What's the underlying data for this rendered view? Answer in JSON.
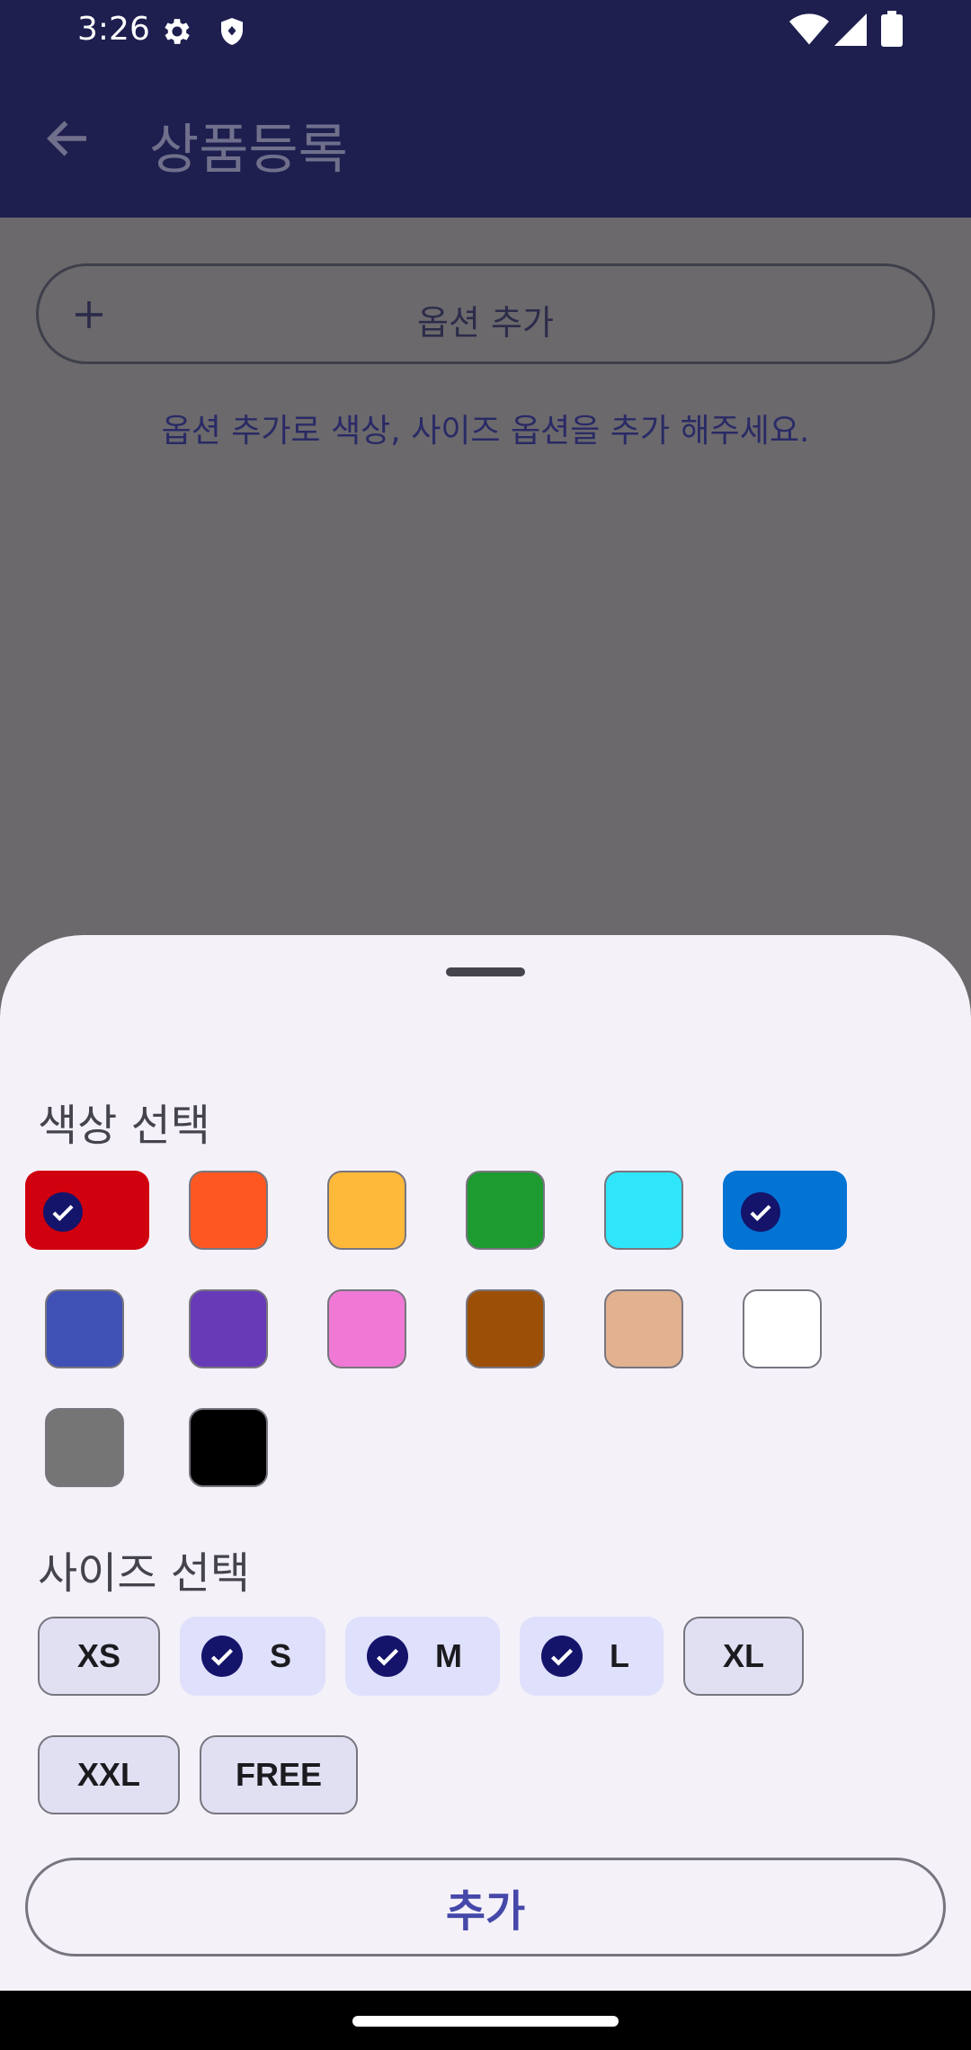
{
  "status_bar": {
    "time": "3:26",
    "icons": [
      "gear-icon",
      "shield-icon",
      "wifi-icon",
      "signal-icon",
      "battery-icon"
    ]
  },
  "app_bar": {
    "back_icon": "arrow-left-icon",
    "title": "상품등록"
  },
  "content": {
    "option_add_label": "옵션 추가",
    "hint": "옵션 추가로 색상, 사이즈 옵션을 추가 해주세요."
  },
  "sheet": {
    "color_section_title": "색상 선택",
    "colors": [
      {
        "hex": "#d1000f",
        "selected": true
      },
      {
        "hex": "#ff5722",
        "selected": false
      },
      {
        "hex": "#ffb93a",
        "selected": false
      },
      {
        "hex": "#1d9a30",
        "selected": false
      },
      {
        "hex": "#2fe5fa",
        "selected": false
      },
      {
        "hex": "#0474d4",
        "selected": true
      },
      {
        "hex": "#3f51b5",
        "selected": false
      },
      {
        "hex": "#673ab7",
        "selected": false
      },
      {
        "hex": "#ef79d4",
        "selected": false
      },
      {
        "hex": "#9c4f07",
        "selected": false
      },
      {
        "hex": "#e2b190",
        "selected": false
      },
      {
        "hex": "#ffffff",
        "selected": false
      },
      {
        "hex": "#757575",
        "selected": false
      },
      {
        "hex": "#000000",
        "selected": false
      }
    ],
    "size_section_title": "사이즈 선택",
    "sizes": [
      {
        "label": "XS",
        "selected": false
      },
      {
        "label": "S",
        "selected": true
      },
      {
        "label": "M",
        "selected": true
      },
      {
        "label": "L",
        "selected": true
      },
      {
        "label": "XL",
        "selected": false
      },
      {
        "label": "XXL",
        "selected": false
      },
      {
        "label": "FREE",
        "selected": false
      }
    ],
    "add_button_label": "추가"
  }
}
